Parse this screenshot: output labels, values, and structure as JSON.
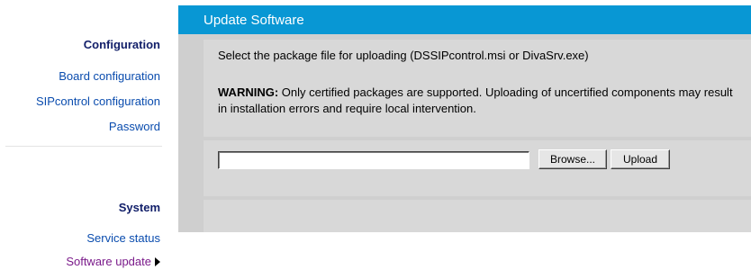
{
  "sidebar": {
    "configuration": {
      "heading": "Configuration",
      "items": [
        {
          "label": "Board configuration"
        },
        {
          "label": "SIPcontrol configuration"
        },
        {
          "label": "Password"
        }
      ]
    },
    "system": {
      "heading": "System",
      "items": [
        {
          "label": "Service status"
        },
        {
          "label": "Software update",
          "active": true
        }
      ]
    }
  },
  "main": {
    "title": "Update Software",
    "info_text": "Select the package file for uploading (DSSIPcontrol.msi or DivaSrv.exe)",
    "warning_label": "WARNING:",
    "warning_text": " Only certified packages are supported. Uploading of uncertified components may result in installation errors and require local intervention.",
    "file_input_value": "",
    "browse_label": "Browse...",
    "upload_label": "Upload"
  },
  "colors": {
    "header": "#0897d4",
    "panel": "#d8d8d8",
    "link": "#0a4cae",
    "active_link": "#7a1a8a",
    "heading": "#13206a"
  }
}
